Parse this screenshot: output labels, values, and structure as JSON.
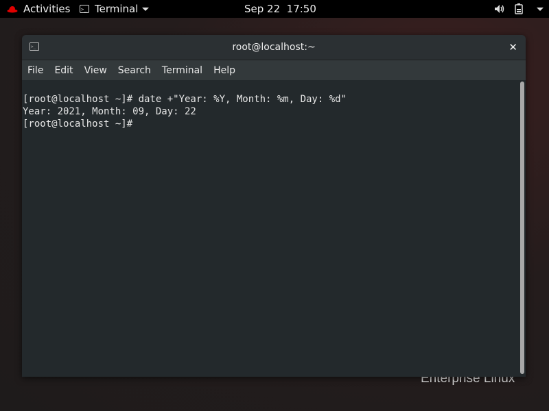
{
  "topbar": {
    "activities": "Activities",
    "app_menu": "Terminal",
    "clock": "Sep 22  17:50",
    "icons": [
      "redhat-logo-icon",
      "terminal-icon",
      "volume-icon",
      "battery-icon",
      "system-menu-caret-icon"
    ]
  },
  "window": {
    "title": "root@localhost:~",
    "close_glyph": "✕",
    "menu": [
      "File",
      "Edit",
      "View",
      "Search",
      "Terminal",
      "Help"
    ]
  },
  "terminal": {
    "lines": [
      "[root@localhost ~]# date +\"Year: %Y, Month: %m, Day: %d\"",
      "Year: 2021, Month: 09, Day: 22",
      "[root@localhost ~]#"
    ]
  },
  "desktop": {
    "watermark": "Enterprise Linux"
  },
  "colors": {
    "accent_red": "#e00000",
    "terminal_bg": "#23292c",
    "terminal_fg": "#e6e6e6"
  }
}
